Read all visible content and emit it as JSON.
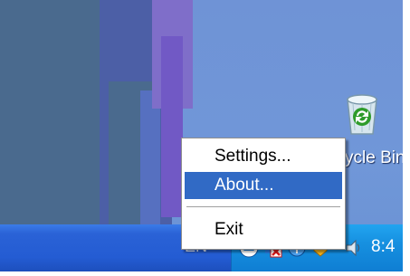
{
  "desktop": {
    "recycle_bin": {
      "label": "ycle Bin",
      "icon": "recycle-bin-icon"
    }
  },
  "taskbar": {
    "language": "EN",
    "clock": "8:4",
    "tray_icons": [
      "network-icon",
      "flag-icon",
      "security-icon",
      "volume-icon"
    ]
  },
  "context_menu": {
    "items": [
      {
        "label": "Settings...",
        "highlighted": false
      },
      {
        "label": "About...",
        "highlighted": true
      },
      {
        "label": "Exit",
        "highlighted": false
      }
    ]
  },
  "colors": {
    "taskbar": "#245cd3",
    "tray": "#1690e0",
    "menu_highlight": "#316ac5",
    "desktop": "#6f93d6"
  }
}
